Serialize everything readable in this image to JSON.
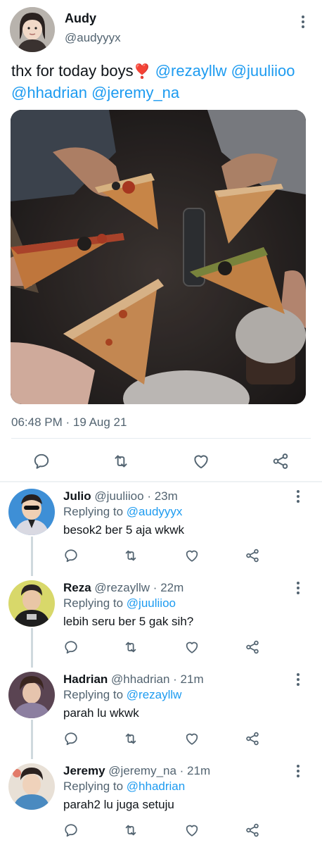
{
  "colors": {
    "accent": "#1d9bf0",
    "text": "#0f1419",
    "muted": "#536471",
    "divider": "#e6ecf0"
  },
  "tweet": {
    "author_name": "Audy",
    "author_handle": "@audyyyx",
    "text_intro": "thx for today boys",
    "emoji": "❣️",
    "mentions": [
      "@rezayllw",
      "@juuliioo",
      "@hhadrian",
      "@jeremy_na"
    ],
    "timestamp": "06:48 PM · 19 Aug 21",
    "photo_alt_icons": [
      "pizza-photo"
    ]
  },
  "actions": [
    "reply-icon",
    "retweet-icon",
    "like-icon",
    "share-icon"
  ],
  "replies": [
    {
      "name": "Julio",
      "meta": "@juuliioo · 23m",
      "replying_label": "Replying to",
      "replying_to": "@audyyyx",
      "text": "besok2 ber 5 aja wkwk"
    },
    {
      "name": "Reza",
      "meta": "@rezayllw · 22m",
      "replying_label": "Replying to",
      "replying_to": "@juuliioo",
      "text": "lebih seru ber 5 gak sih?"
    },
    {
      "name": "Hadrian",
      "meta": "@hhadrian · 21m",
      "replying_label": "Replying to",
      "replying_to": "@rezayllw",
      "text": "parah lu wkwk"
    },
    {
      "name": "Jeremy",
      "meta": "@jeremy_na · 21m",
      "replying_label": "Replying to",
      "replying_to": "@hhadrian",
      "text": "parah2 lu juga setuju"
    }
  ]
}
